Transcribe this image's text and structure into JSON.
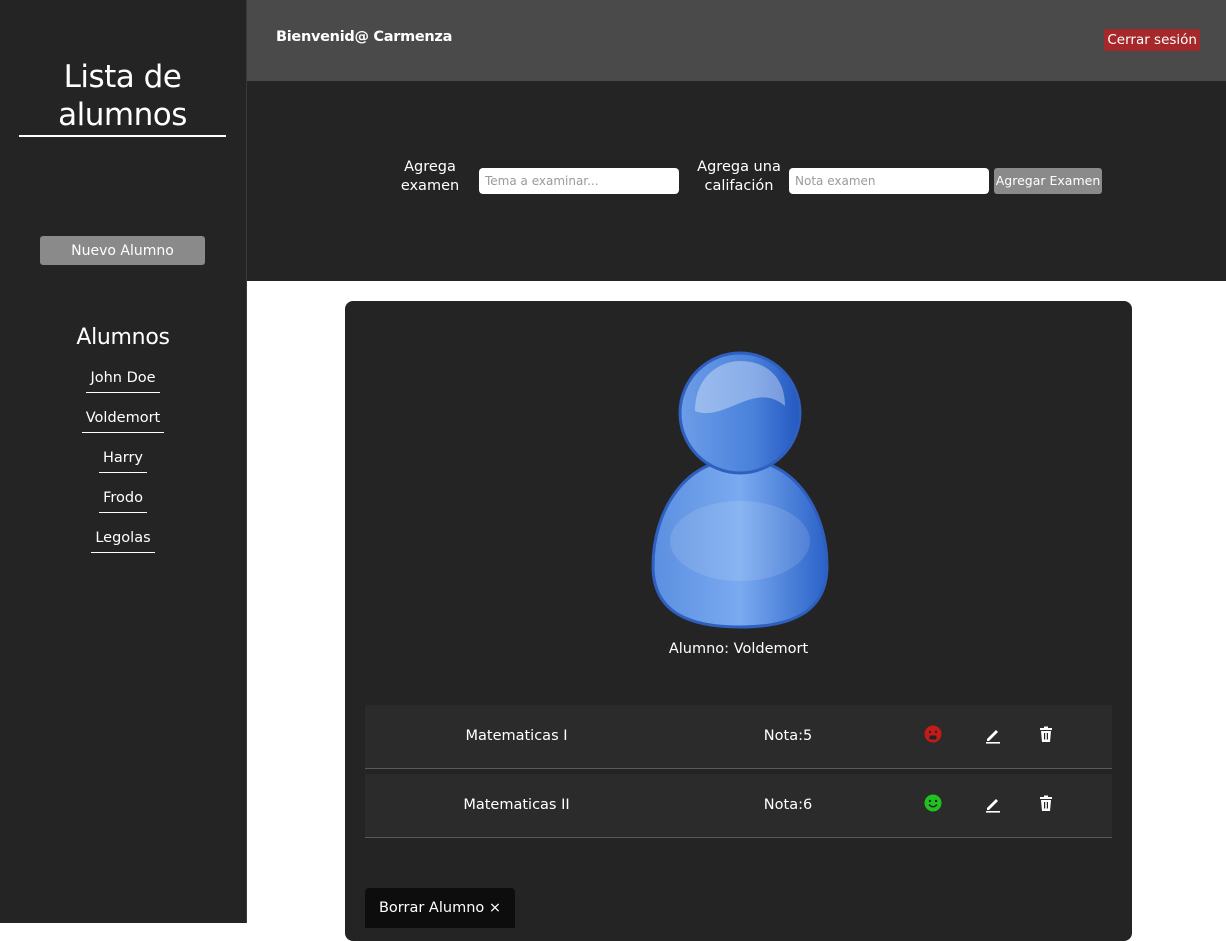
{
  "sidebar": {
    "title": "Lista de alumnos",
    "new_student_label": "Nuevo Alumno",
    "students_heading": "Alumnos",
    "students": [
      "John Doe",
      "Voldemort",
      "Harry",
      "Frodo",
      "Legolas"
    ]
  },
  "header": {
    "welcome": "Bienvenid@ Carmenza",
    "logout_label": "Cerrar sesión",
    "logout_color": "#a5282b"
  },
  "exam_form": {
    "topic_label": "Agrega examen",
    "topic_placeholder": "Tema a examinar...",
    "topic_value": "",
    "grade_label": "Agrega una califación",
    "grade_placeholder": "Nota examen",
    "grade_value": "",
    "submit_label": "Agregar Examen"
  },
  "student_card": {
    "avatar_icon": "user-avatar-icon",
    "name_label": "Alumno: Voldemort",
    "exams": [
      {
        "subject": "Matematicas I",
        "grade": "Nota:5",
        "status_icon": "sad-face-icon",
        "status_color": "#c41a1a"
      },
      {
        "subject": "Matematicas II",
        "grade": "Nota:6",
        "status_icon": "happy-face-icon",
        "status_color": "#1fc21f"
      }
    ],
    "edit_icon": "pencil-icon",
    "delete_icon": "trash-icon",
    "delete_student_label": "Borrar Alumno ×"
  }
}
